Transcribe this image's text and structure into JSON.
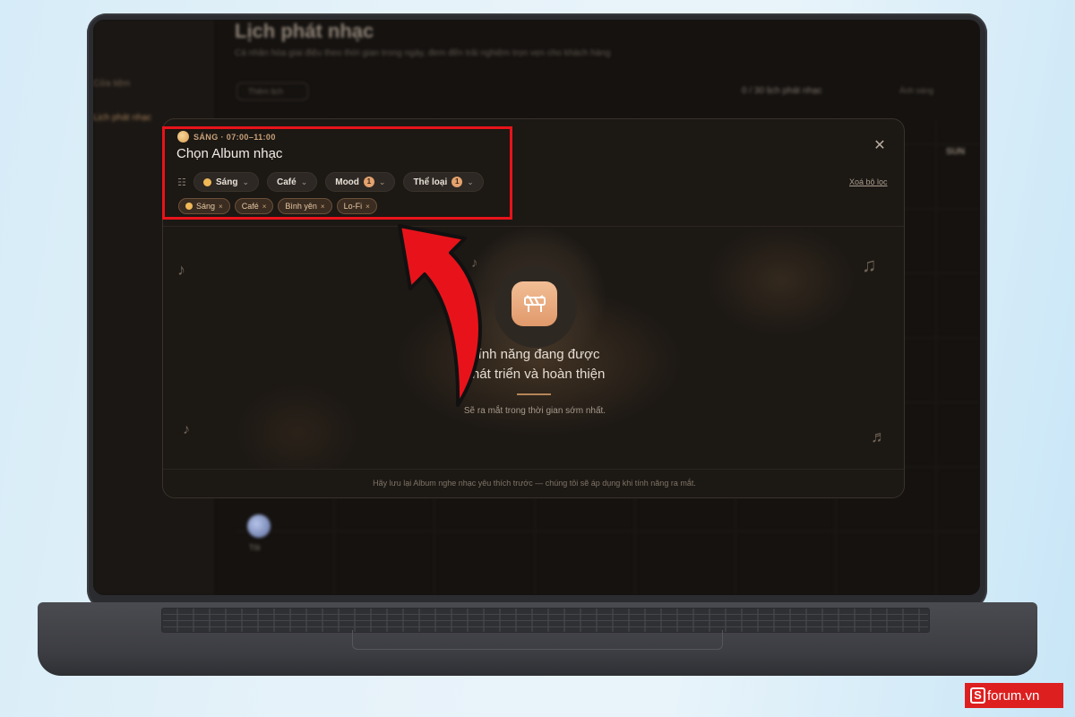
{
  "background_app": {
    "title": "Lịch phát nhạc",
    "subtitle": "Cá nhân hóa giai điệu theo thời gian trong ngày, đem đến trải nghiệm trọn vẹn cho khách hàng",
    "sidebar_items": [
      "",
      "Cửa tiệm",
      "Lịch phát nhạc"
    ],
    "add_button": "Thêm lịch",
    "schedule_count": "0 / 30 lịch phát nhạc",
    "right_label": "Ánh sáng",
    "column_head": "SUN",
    "avatar_label": "Tôi"
  },
  "modal": {
    "period_label": "SÁNG · 07:00–11:00",
    "title": "Chọn Album nhạc",
    "close_icon": "close-icon",
    "filters": [
      {
        "label": "Sáng",
        "has_sun": true,
        "badge": ""
      },
      {
        "label": "Café",
        "has_sun": false,
        "badge": ""
      },
      {
        "label": "Mood",
        "has_sun": false,
        "badge": "1"
      },
      {
        "label": "Thể loại",
        "has_sun": false,
        "badge": "1"
      }
    ],
    "clear_filters": "Xoá bộ lọc",
    "tags": [
      {
        "label": "Sáng",
        "has_sun": true
      },
      {
        "label": "Café",
        "has_sun": false
      },
      {
        "label": "Bình yên",
        "has_sun": false
      },
      {
        "label": "Lo-Fi",
        "has_sun": false
      }
    ],
    "feature_title_line1": "Tính năng đang được",
    "feature_title_line2": "phát triển và hoàn thiện",
    "feature_subtitle": "Sẽ ra mắt trong thời gian sớm nhất.",
    "footer_note": "Hãy lưu lại Album nghe nhạc yêu thích trước — chúng tôi sẽ áp dụng khi tính năng ra mắt."
  },
  "colors": {
    "accent": "#e3a26e",
    "annotation": "#e8131a",
    "watermark": "#dd1f1f"
  },
  "watermark": {
    "text": "forum.vn",
    "logo_letter": "S"
  }
}
